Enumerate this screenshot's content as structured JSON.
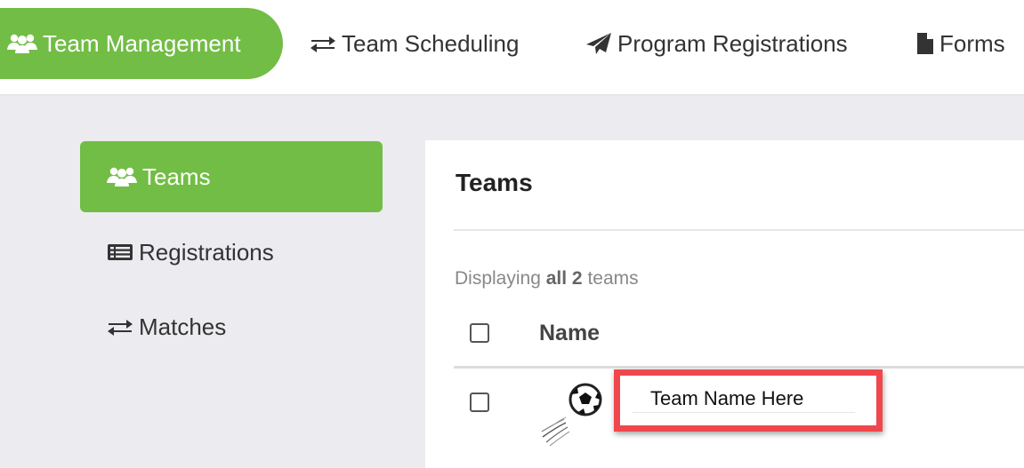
{
  "topnav": {
    "items": [
      {
        "label": "Team Management",
        "icon": "users-icon",
        "active": true
      },
      {
        "label": "Team Scheduling",
        "icon": "exchange-icon",
        "active": false
      },
      {
        "label": "Program Registrations",
        "icon": "paper-plane-icon",
        "active": false
      },
      {
        "label": "Forms",
        "icon": "document-icon",
        "active": false
      }
    ]
  },
  "sidebar": {
    "items": [
      {
        "label": "Teams",
        "icon": "users-icon",
        "active": true
      },
      {
        "label": "Registrations",
        "icon": "list-icon",
        "active": false
      },
      {
        "label": "Matches",
        "icon": "exchange-icon",
        "active": false
      }
    ]
  },
  "panel": {
    "title": "Teams",
    "display_prefix": "Displaying",
    "display_bold": "all 2",
    "display_suffix": "teams",
    "table": {
      "columns": [
        "Name"
      ],
      "rows": [
        {
          "name": "Team Name Here",
          "logo": "soccer-ball-icon"
        }
      ]
    }
  },
  "colors": {
    "accent": "#72bd45",
    "highlight": "#f0474d",
    "background": "#ececf0"
  }
}
